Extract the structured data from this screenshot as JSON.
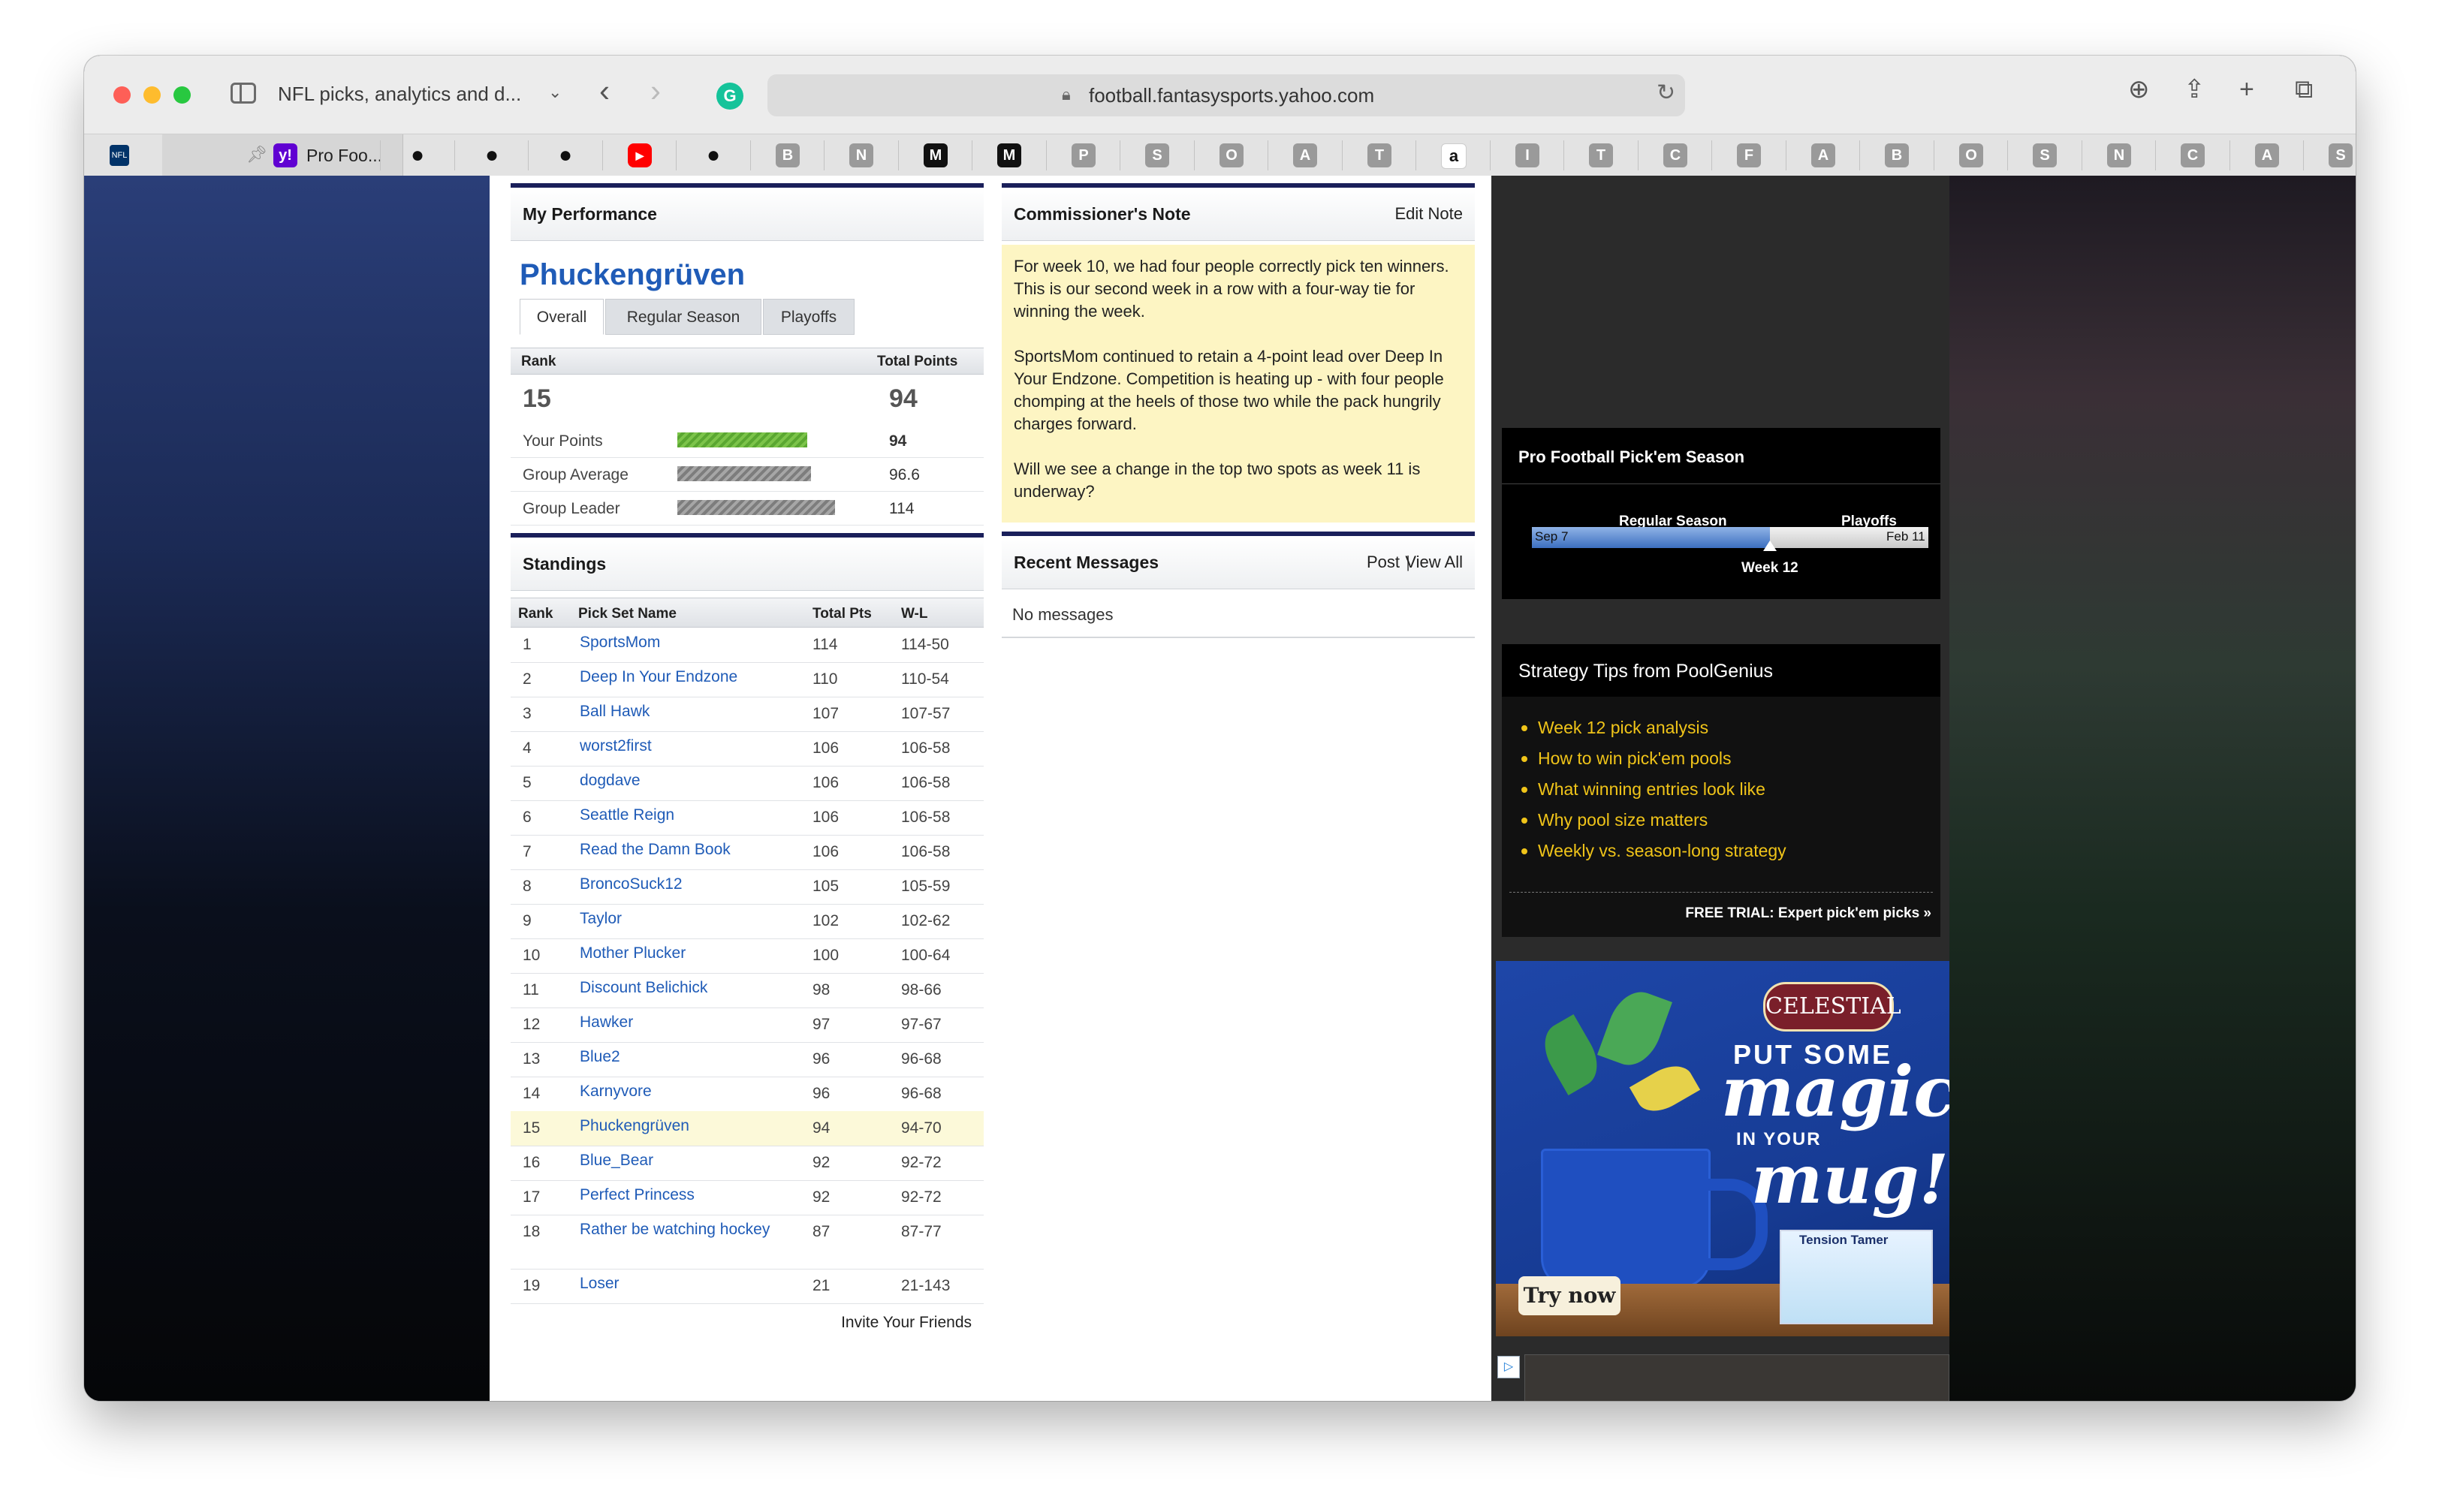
{
  "browser": {
    "tab_title": "NFL picks, analytics and d...",
    "url": "football.fantasysports.yahoo.com",
    "pinned_tab_label": "Pro Foo...",
    "bookmarks": [
      {
        "icon": "github-icon",
        "label": ""
      },
      {
        "icon": "github-icon",
        "label": ""
      },
      {
        "icon": "github-icon",
        "label": ""
      },
      {
        "icon": "youtube-icon",
        "label": ""
      },
      {
        "icon": "github-icon",
        "label": ""
      },
      {
        "icon": "letter-icon",
        "label": "B"
      },
      {
        "icon": "letter-icon",
        "label": "N"
      },
      {
        "icon": "medium-icon",
        "label": "M"
      },
      {
        "icon": "medium-icon",
        "label": "M"
      },
      {
        "icon": "letter-icon",
        "label": "P"
      },
      {
        "icon": "letter-icon",
        "label": "S"
      },
      {
        "icon": "letter-icon",
        "label": "O"
      },
      {
        "icon": "letter-icon",
        "label": "A"
      },
      {
        "icon": "letter-icon",
        "label": "T"
      },
      {
        "icon": "amazon-icon",
        "label": "a"
      },
      {
        "icon": "letter-icon",
        "label": "I"
      },
      {
        "icon": "letter-icon",
        "label": "T"
      },
      {
        "icon": "letter-icon",
        "label": "C"
      },
      {
        "icon": "letter-icon",
        "label": "F"
      },
      {
        "icon": "letter-icon",
        "label": "A"
      },
      {
        "icon": "letter-icon",
        "label": "B"
      },
      {
        "icon": "letter-icon",
        "label": "O"
      },
      {
        "icon": "letter-icon",
        "label": "S"
      },
      {
        "icon": "letter-icon",
        "label": "N"
      },
      {
        "icon": "letter-icon",
        "label": "C"
      },
      {
        "icon": "letter-icon",
        "label": "A"
      },
      {
        "icon": "letter-icon",
        "label": "S"
      }
    ]
  },
  "performance": {
    "title": "My Performance",
    "team_name": "Phuckengrüven",
    "tabs": [
      "Overall",
      "Regular Season",
      "Playoffs"
    ],
    "active_tab": "Overall",
    "rank_header": "Rank",
    "points_header": "Total Points",
    "rank": "15",
    "total_points": "94",
    "stats": [
      {
        "label": "Your Points",
        "value": "94",
        "fraction": 0.8245,
        "style": "green"
      },
      {
        "label": "Group Average",
        "value": "96.6",
        "fraction": 0.8474,
        "style": "grey"
      },
      {
        "label": "Group Leader",
        "value": "114",
        "fraction": 1.0,
        "style": "grey"
      }
    ]
  },
  "standings": {
    "title": "Standings",
    "columns": [
      "Rank",
      "Pick Set Name",
      "Total Pts",
      "W-L"
    ],
    "rows": [
      {
        "rank": "1",
        "name": "SportsMom",
        "pts": "114",
        "wl": "114-50"
      },
      {
        "rank": "2",
        "name": "Deep In Your Endzone",
        "pts": "110",
        "wl": "110-54"
      },
      {
        "rank": "3",
        "name": "Ball Hawk",
        "pts": "107",
        "wl": "107-57"
      },
      {
        "rank": "4",
        "name": "worst2first",
        "pts": "106",
        "wl": "106-58"
      },
      {
        "rank": "5",
        "name": "dogdave",
        "pts": "106",
        "wl": "106-58"
      },
      {
        "rank": "6",
        "name": "Seattle Reign",
        "pts": "106",
        "wl": "106-58"
      },
      {
        "rank": "7",
        "name": "Read the Damn Book",
        "pts": "106",
        "wl": "106-58"
      },
      {
        "rank": "8",
        "name": "BroncoSuck12",
        "pts": "105",
        "wl": "105-59"
      },
      {
        "rank": "9",
        "name": "Taylor",
        "pts": "102",
        "wl": "102-62"
      },
      {
        "rank": "10",
        "name": "Mother Plucker",
        "pts": "100",
        "wl": "100-64"
      },
      {
        "rank": "11",
        "name": "Discount Belichick",
        "pts": "98",
        "wl": "98-66"
      },
      {
        "rank": "12",
        "name": "Hawker",
        "pts": "97",
        "wl": "97-67"
      },
      {
        "rank": "13",
        "name": "Blue2",
        "pts": "96",
        "wl": "96-68"
      },
      {
        "rank": "14",
        "name": "Karnyvore",
        "pts": "96",
        "wl": "96-68"
      },
      {
        "rank": "15",
        "name": "Phuckengrüven",
        "pts": "94",
        "wl": "94-70",
        "highlight": true
      },
      {
        "rank": "16",
        "name": "Blue_Bear",
        "pts": "92",
        "wl": "92-72"
      },
      {
        "rank": "17",
        "name": "Perfect Princess",
        "pts": "92",
        "wl": "92-72"
      },
      {
        "rank": "18",
        "name": "Rather be watching hockey",
        "pts": "87",
        "wl": "87-77"
      },
      {
        "rank": "19",
        "name": "Loser",
        "pts": "21",
        "wl": "21-143"
      }
    ],
    "invite_label": "Invite Your Friends"
  },
  "note": {
    "title": "Commissioner's Note",
    "edit_label": "Edit Note",
    "paragraphs": [
      "For week 10, we had four people correctly pick ten winners. This is our second week in a row with a four-way tie for winning the week.",
      "SportsMom continued to retain a 4-point lead over Deep In Your Endzone. Competition is heating up - with four people chomping at the heels of those two while the pack hungrily charges forward.",
      "Will we see a change in the top two spots as week 11 is underway?"
    ]
  },
  "messages": {
    "title": "Recent Messages",
    "post_label": "Post",
    "divider": "|",
    "view_all_label": "View All",
    "empty_text": "No messages"
  },
  "season": {
    "title": "Pro Football Pick'em Season",
    "regular_label": "Regular Season",
    "playoffs_label": "Playoffs",
    "start_date": "Sep 7",
    "end_date": "Feb 11",
    "current_week": "Week 12",
    "progress": 0.6
  },
  "tips": {
    "title": "Strategy Tips from PoolGenius",
    "items": [
      "Week 12 pick analysis",
      "How to win pick'em pools",
      "What winning entries look like",
      "Why pool size matters",
      "Weekly vs. season-long strategy"
    ],
    "free_trial": "FREE TRIAL: Expert pick'em picks »"
  },
  "ad": {
    "brand": "CELESTIAL",
    "line1": "PUT SOME",
    "magic": "magic",
    "in_your": "IN YOUR",
    "mug": "mug!",
    "product": "Tension Tamer",
    "cta": "Try now"
  },
  "colors": {
    "link": "#1f5bb7",
    "panel_border": "#1a1f5a",
    "note_bg": "#fdf5c3",
    "highlight_row": "#fcf9d9",
    "tip_text": "#f0c419"
  }
}
